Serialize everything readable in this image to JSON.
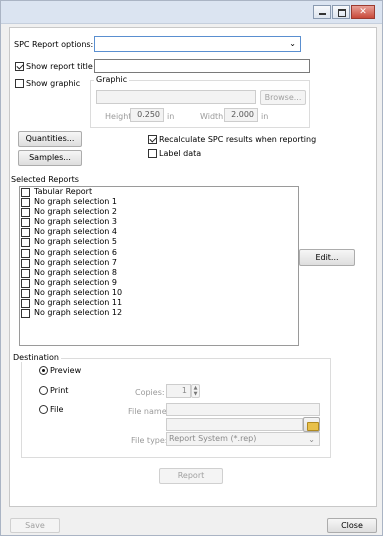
{
  "spc": {
    "label": "SPC Report options:",
    "value": ""
  },
  "show_title": {
    "label": "Show report title",
    "checked": true,
    "value": ""
  },
  "show_graphic": {
    "label": "Show graphic",
    "checked": false
  },
  "graphic": {
    "label": "Graphic",
    "browse": "Browse...",
    "height_label": "Height:",
    "height_value": "0.250",
    "height_unit": "in",
    "width_label": "Width:",
    "width_value": "2.000",
    "width_unit": "in"
  },
  "quantities": "Quantities...",
  "samples": "Samples...",
  "recalc": {
    "label": "Recalculate SPC results when reporting",
    "checked": true
  },
  "label_data": {
    "label": "Label data",
    "checked": false
  },
  "selected_reports": {
    "label": "Selected Reports",
    "items": [
      "Tabular Report",
      "No graph selection 1",
      "No graph selection 2",
      "No graph selection 3",
      "No graph selection 4",
      "No graph selection 5",
      "No graph selection 6",
      "No graph selection 7",
      "No graph selection 8",
      "No graph selection 9",
      "No graph selection 10",
      "No graph selection 11",
      "No graph selection 12"
    ]
  },
  "edit": "Edit...",
  "destination": {
    "label": "Destination",
    "preview": "Preview",
    "print": "Print",
    "file": "File",
    "selected": "Preview",
    "copies_label": "Copies:",
    "copies_value": "1",
    "filename_label": "File name:",
    "filetype_label": "File type:",
    "filetype_value": "Report System (*.rep)"
  },
  "report": "Report",
  "save": "Save",
  "close": "Close"
}
